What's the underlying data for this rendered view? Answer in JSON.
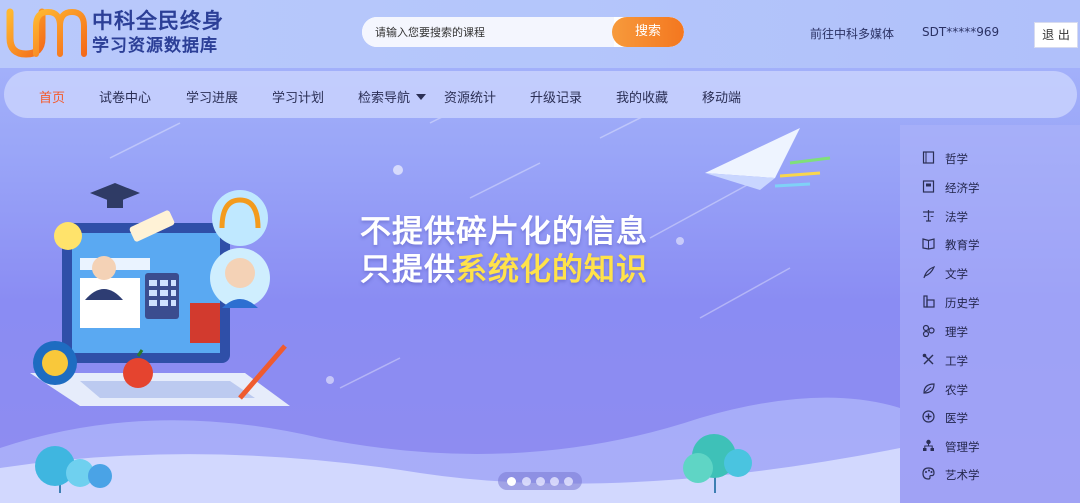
{
  "header": {
    "logo_line1": "中科全民终身",
    "logo_line2": "学习资源数据库",
    "search_placeholder": "请输入您要搜索的课程",
    "search_button": "搜索",
    "media_link": "前往中科多媒体",
    "user_id": "SDT*****969",
    "logout": "退 出"
  },
  "nav": {
    "items": [
      {
        "label": "首页",
        "active": true
      },
      {
        "label": "试卷中心"
      },
      {
        "label": "学习进展"
      },
      {
        "label": "学习计划"
      },
      {
        "label": "检索导航"
      },
      {
        "label": "资源统计"
      },
      {
        "label": "升级记录"
      },
      {
        "label": "我的收藏"
      },
      {
        "label": "移动端"
      }
    ]
  },
  "categories": [
    {
      "label": "哲学",
      "icon": "book-icon"
    },
    {
      "label": "经济学",
      "icon": "ledger-icon"
    },
    {
      "label": "法学",
      "icon": "scales-icon"
    },
    {
      "label": "教育学",
      "icon": "open-book-icon"
    },
    {
      "label": "文学",
      "icon": "quill-icon"
    },
    {
      "label": "历史学",
      "icon": "scroll-icon"
    },
    {
      "label": "理学",
      "icon": "atom-icon"
    },
    {
      "label": "工学",
      "icon": "tools-icon"
    },
    {
      "label": "农学",
      "icon": "leaf-icon"
    },
    {
      "label": "医学",
      "icon": "medical-cross-icon"
    },
    {
      "label": "管理学",
      "icon": "org-chart-icon"
    },
    {
      "label": "艺术学",
      "icon": "palette-icon"
    }
  ],
  "banner": {
    "slogan_line1": "不提供碎片化的信息",
    "slogan_line2_prefix": "只提供",
    "slogan_line2_highlight": "系统化的知识",
    "highlight_color": "#ffe24a",
    "slide_count": 5,
    "active_slide": 1
  },
  "colors": {
    "accent": "#f4771f",
    "nav_active": "#f55a2a",
    "brand": "#2c3f97"
  }
}
